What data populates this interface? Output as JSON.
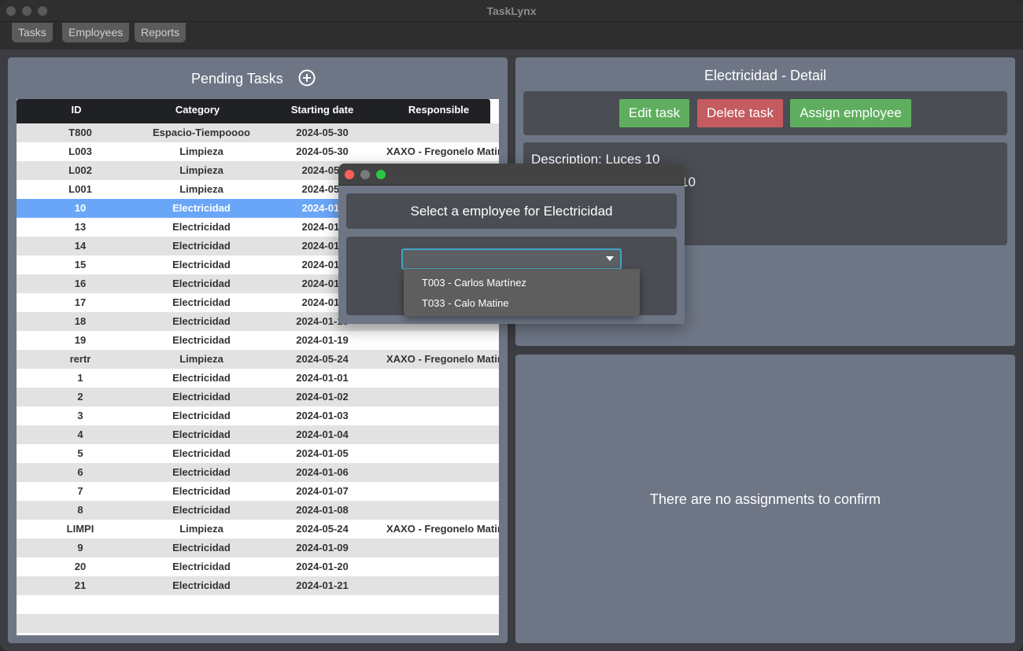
{
  "window": {
    "title": "TaskLynx"
  },
  "menu": {
    "items": [
      "Tasks",
      "Employees",
      "Reports"
    ]
  },
  "pending": {
    "title": "Pending Tasks",
    "add_icon": "plus-circle-icon",
    "columns": [
      "ID",
      "Category",
      "Starting date",
      "Responsible"
    ],
    "rows": [
      [
        "T800",
        "Espacio-Tiempoooo",
        "2024-05-30",
        ""
      ],
      [
        "L003",
        "Limpieza",
        "2024-05-30",
        "XAXO - Fregonelo Matine"
      ],
      [
        "L002",
        "Limpieza",
        "2024-05-",
        ""
      ],
      [
        "L001",
        "Limpieza",
        "2024-05-",
        ""
      ],
      [
        "10",
        "Electricidad",
        "2024-01-",
        ""
      ],
      [
        "13",
        "Electricidad",
        "2024-01-",
        ""
      ],
      [
        "14",
        "Electricidad",
        "2024-01-",
        ""
      ],
      [
        "15",
        "Electricidad",
        "2024-01-",
        ""
      ],
      [
        "16",
        "Electricidad",
        "2024-01-",
        ""
      ],
      [
        "17",
        "Electricidad",
        "2024-01-",
        ""
      ],
      [
        "18",
        "Electricidad",
        "2024-01-18",
        ""
      ],
      [
        "19",
        "Electricidad",
        "2024-01-19",
        ""
      ],
      [
        "rertr",
        "Limpieza",
        "2024-05-24",
        "XAXO - Fregonelo Matine"
      ],
      [
        "1",
        "Electricidad",
        "2024-01-01",
        ""
      ],
      [
        "2",
        "Electricidad",
        "2024-01-02",
        ""
      ],
      [
        "3",
        "Electricidad",
        "2024-01-03",
        ""
      ],
      [
        "4",
        "Electricidad",
        "2024-01-04",
        ""
      ],
      [
        "5",
        "Electricidad",
        "2024-01-05",
        ""
      ],
      [
        "6",
        "Electricidad",
        "2024-01-06",
        ""
      ],
      [
        "7",
        "Electricidad",
        "2024-01-07",
        ""
      ],
      [
        "8",
        "Electricidad",
        "2024-01-08",
        ""
      ],
      [
        "LIMPI",
        "Limpieza",
        "2024-05-24",
        "XAXO - Fregonelo Matine"
      ],
      [
        "9",
        "Electricidad",
        "2024-01-09",
        ""
      ],
      [
        "20",
        "Electricidad",
        "2024-01-20",
        ""
      ],
      [
        "21",
        "Electricidad",
        "2024-01-21",
        ""
      ]
    ],
    "selected_index": 4
  },
  "detail": {
    "title": "Electricidad - Detail",
    "edit_label": "Edit task",
    "delete_label": "Delete task",
    "assign_label": "Assign employee",
    "description_line": "Description:  Luces 10",
    "second_line_fragment": "10",
    "colors": {
      "green": "#5fae5f",
      "red": "#c45b5f"
    }
  },
  "assignments": {
    "empty_text": "There are no assignments to confirm"
  },
  "dialog": {
    "header": "Select a employee for Electricidad",
    "combo_value": "",
    "options": [
      "T003 - Carlos Martínez",
      "T033 - Calo Matine"
    ]
  }
}
